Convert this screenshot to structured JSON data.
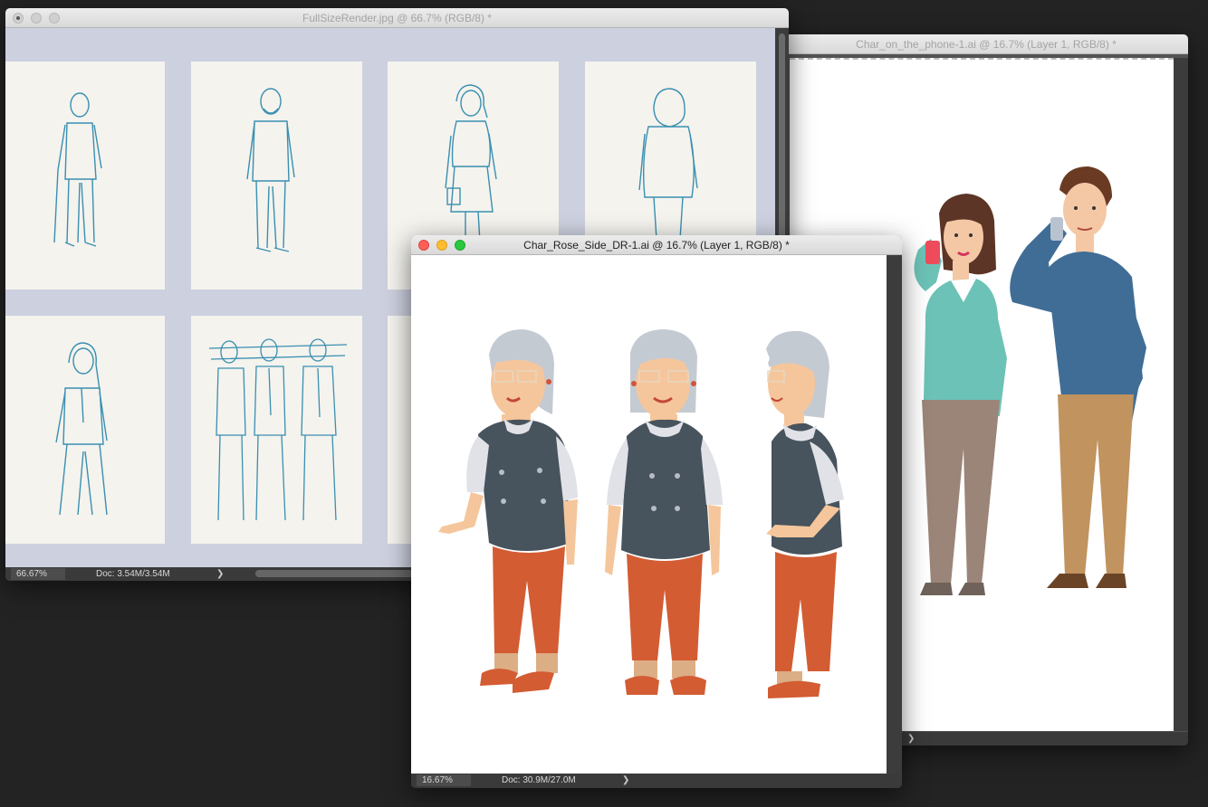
{
  "windows": {
    "sketch": {
      "title": "FullSizeRender.jpg @ 66.7% (RGB/8) *",
      "zoom": "66.67%",
      "doc": "Doc: 3.54M/3.54M",
      "arrow": "❯"
    },
    "phone": {
      "title": "Char_on_the_phone-1.ai @ 16.7% (Layer 1, RGB/8) *",
      "arrow": "❯"
    },
    "rose": {
      "title": "Char_Rose_Side_DR-1.ai @ 16.7% (Layer 1, RGB/8) *",
      "zoom": "16.67%",
      "doc": "Doc: 30.9M/27.0M",
      "arrow": "❯"
    }
  },
  "colors": {
    "desktop": "#232323",
    "sketch_ink": "#3a8fb0",
    "vest": "#47535d",
    "pants": "#d35c33",
    "hair": "#c4cad2",
    "skin": "#f5c69b",
    "blazer": "#6cc2b6",
    "sweater": "#3f6d96"
  },
  "icons": [
    "close-icon",
    "minimize-icon",
    "zoom-icon",
    "chevron-right-icon"
  ]
}
